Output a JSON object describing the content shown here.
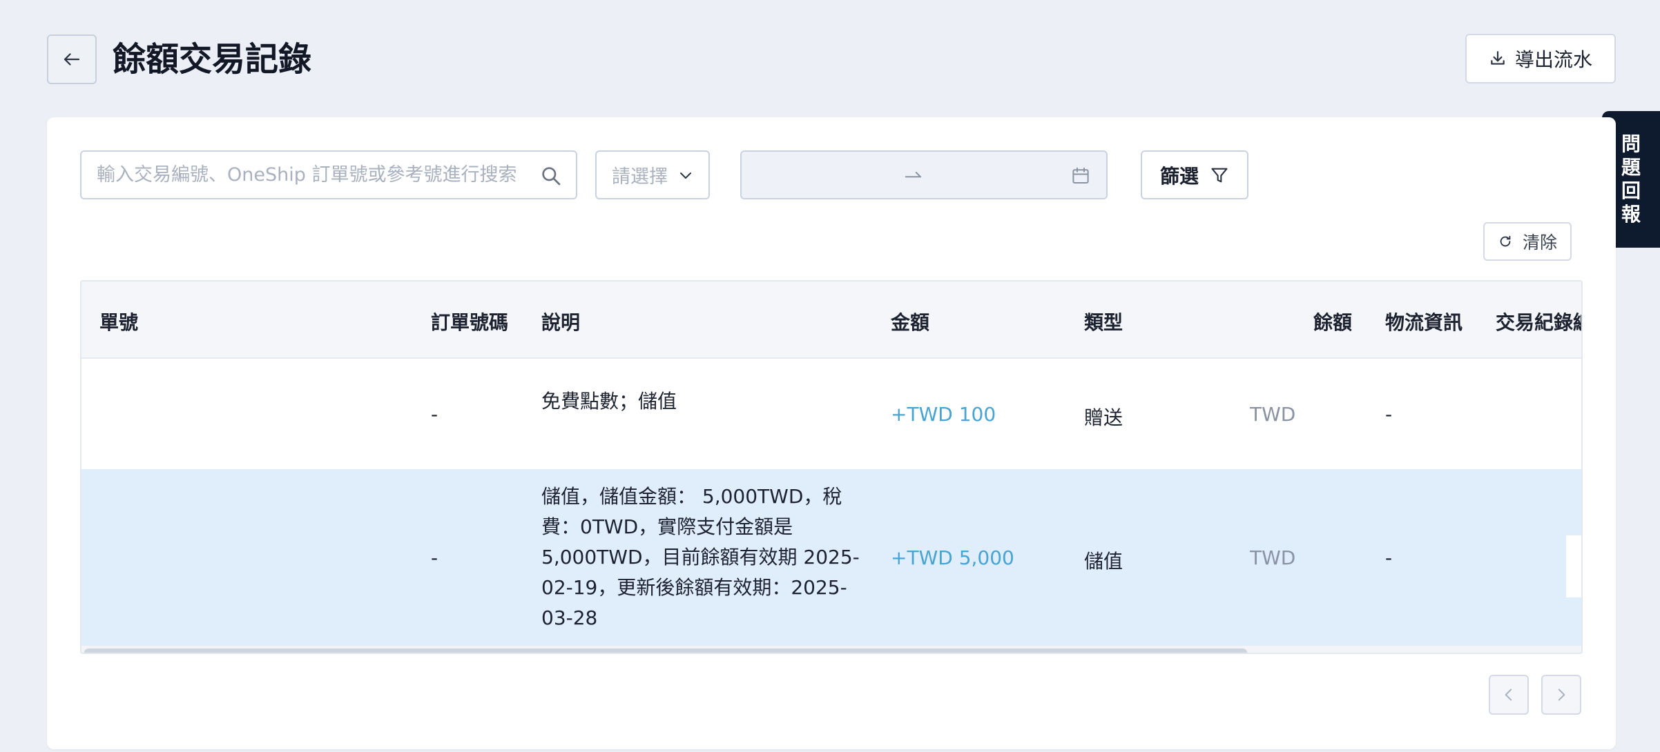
{
  "header": {
    "title": "餘額交易記錄",
    "export_label": "導出流水"
  },
  "feedback": {
    "chars": [
      "問",
      "題",
      "回",
      "報"
    ]
  },
  "filters": {
    "search_placeholder": "輸入交易編號、OneShip 訂單號或參考號進行搜索",
    "select_placeholder": "請選擇",
    "date_separator": "→",
    "filter_label": "篩選",
    "clear_label": "清除"
  },
  "table": {
    "columns": [
      "單號",
      "訂單號碼",
      "說明",
      "金額",
      "類型",
      "餘額",
      "物流資訊",
      "交易紀錄編"
    ],
    "rows": [
      {
        "order_no": "-",
        "description": "免費點數；儲值",
        "amount": "+TWD 100",
        "type": "贈送",
        "balance": "TWD",
        "logistics": "-"
      },
      {
        "order_no": "-",
        "description": "儲值，儲值金額： 5,000TWD，稅費：0TWD，實際支付金額是 5,000TWD，目前餘額有效期 2025-02-19，更新後餘額有效期：2025-03-28",
        "amount": "+TWD 5,000",
        "type": "儲值",
        "balance": "TWD",
        "logistics": "-"
      }
    ]
  },
  "colors": {
    "accent_amount": "#48a4d3",
    "selected_row": "#e0edfb",
    "feedback_bg": "#0e1b2e"
  }
}
